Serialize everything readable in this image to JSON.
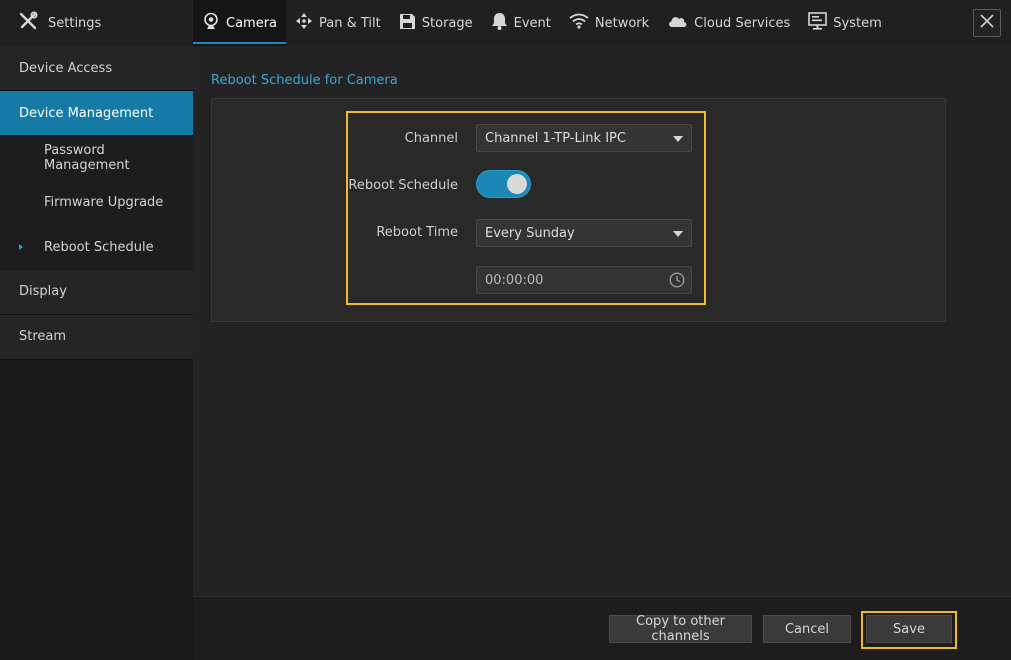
{
  "sidebar": {
    "header": {
      "title": "Settings",
      "icon": "tools-icon"
    },
    "items": [
      {
        "label": "Device Access"
      },
      {
        "label": "Device Management"
      }
    ],
    "subitems": [
      {
        "label": "Password Management"
      },
      {
        "label": "Firmware Upgrade"
      },
      {
        "label": "Reboot Schedule"
      }
    ],
    "items_after": [
      {
        "label": "Display"
      },
      {
        "label": "Stream"
      }
    ]
  },
  "tabs": [
    {
      "label": "Camera",
      "icon": "camera-icon"
    },
    {
      "label": "Pan & Tilt",
      "icon": "pan-tilt-icon"
    },
    {
      "label": "Storage",
      "icon": "floppy-icon"
    },
    {
      "label": "Event",
      "icon": "bell-icon"
    },
    {
      "label": "Network",
      "icon": "wifi-icon"
    },
    {
      "label": "Cloud Services",
      "icon": "cloud-icon"
    },
    {
      "label": "System",
      "icon": "monitor-icon"
    }
  ],
  "main": {
    "section_title": "Reboot Schedule for Camera",
    "channel": {
      "label": "Channel",
      "value": "Channel 1-TP-Link IPC"
    },
    "reboot_schedule": {
      "label": "Reboot Schedule",
      "enabled": true
    },
    "reboot_time": {
      "label": "Reboot Time",
      "value": "Every Sunday",
      "time": "00:00:00"
    }
  },
  "footer": {
    "copy_label": "Copy to other channels",
    "cancel_label": "Cancel",
    "save_label": "Save"
  },
  "colors": {
    "accent": "#157aa6",
    "highlight": "#f2b833",
    "link": "#3ea5d6"
  }
}
